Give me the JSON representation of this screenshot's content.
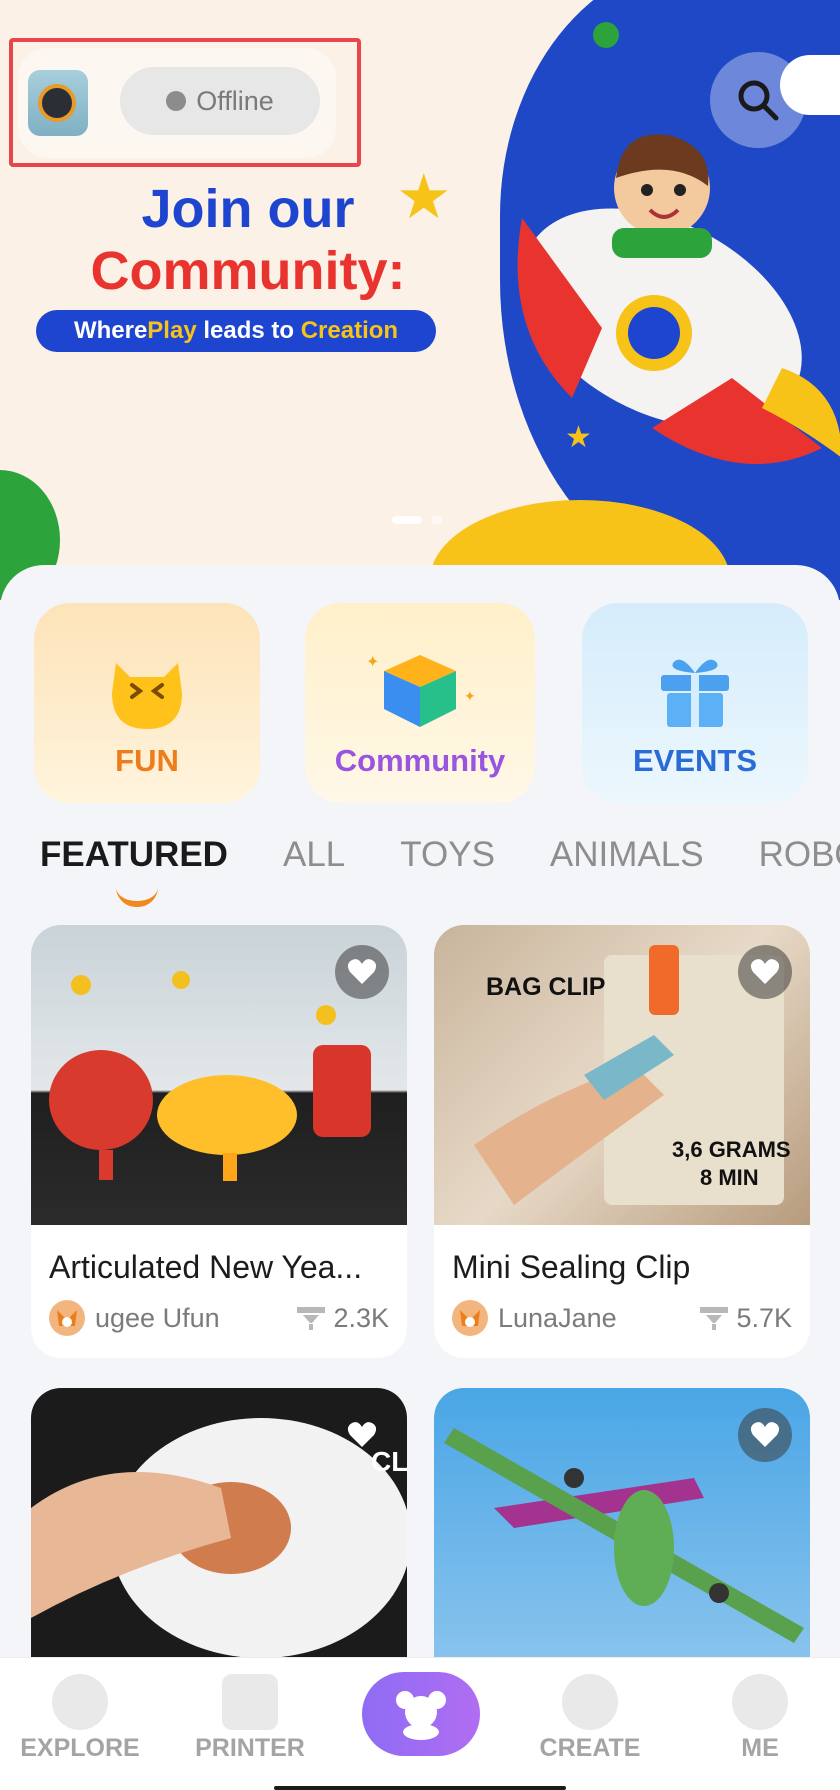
{
  "header": {
    "status_label": "Offline"
  },
  "banner": {
    "headline_1": "Join our",
    "headline_2": "Community:",
    "tagline_1": "Where ",
    "tagline_2": "Play",
    "tagline_3": " leads to ",
    "tagline_4": "Creation"
  },
  "categories": [
    {
      "label": "FUN"
    },
    {
      "label": "Community"
    },
    {
      "label": "EVENTS"
    }
  ],
  "tabs": [
    "FEATURED",
    "ALL",
    "TOYS",
    "ANIMALS",
    "ROBOTS"
  ],
  "cards": [
    {
      "title": "Articulated New Yea...",
      "author": "ugee Ufun",
      "downloads": "2.3K"
    },
    {
      "title": "Mini Sealing Clip",
      "author": "LunaJane",
      "downloads": "5.7K",
      "overlay_1": "BAG CLIP",
      "overlay_2": "3,6 GRAMS",
      "overlay_3": "8 MIN"
    },
    {
      "overlay": "CL"
    },
    {}
  ],
  "bottom_nav": [
    "EXPLORE",
    "PRINTER",
    "",
    "CREATE",
    "ME"
  ],
  "colors": {
    "accent_orange": "#f18a1e",
    "brand_blue": "#1e45d0",
    "brand_red": "#e8332f",
    "nav_purple": "#9b6cf4"
  }
}
